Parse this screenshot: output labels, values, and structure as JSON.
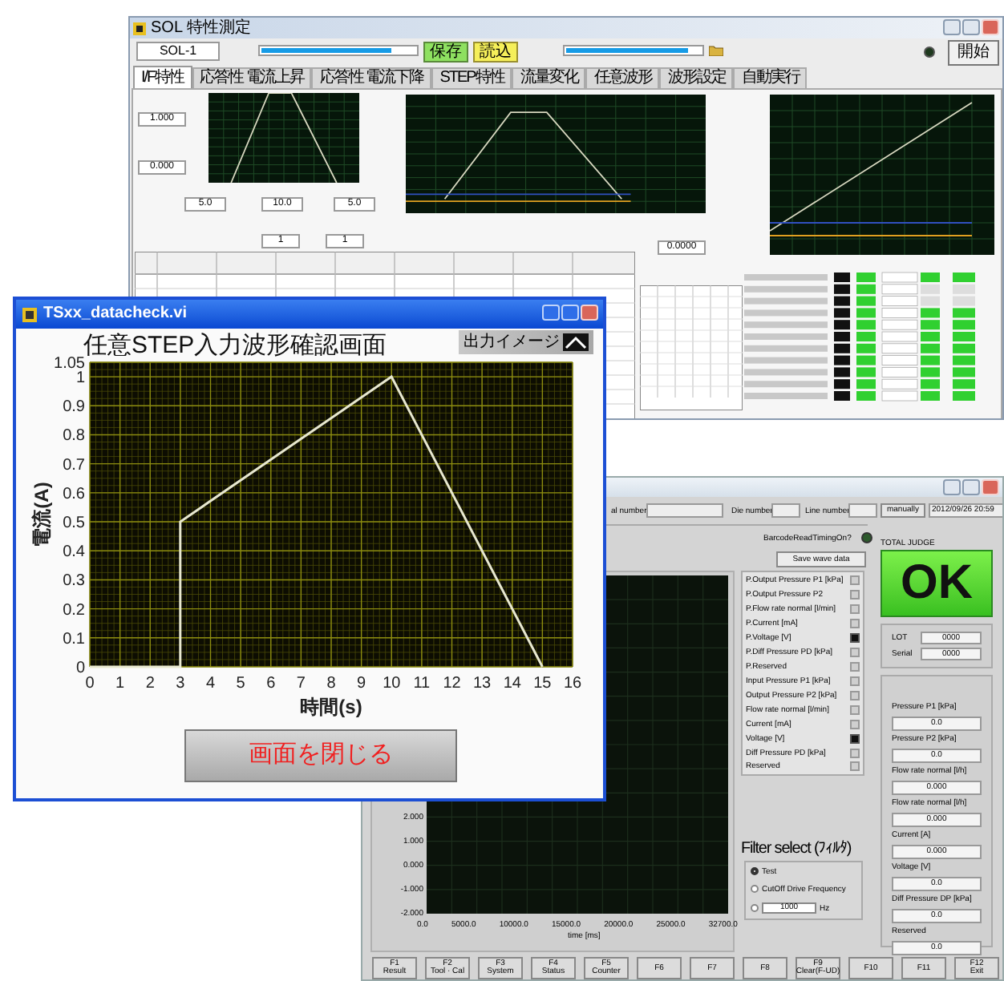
{
  "main_window": {
    "title": "SOL 特性測定",
    "device": "SOL-1",
    "save_button": "保存",
    "load_button": "読込",
    "start_button": "開始",
    "tabs": [
      {
        "label": "I/F特性",
        "selected": true
      },
      {
        "label": "応答性 電流上昇",
        "selected": false
      },
      {
        "label": "応答性 電流下降",
        "selected": false
      },
      {
        "label": "STEP特性",
        "selected": false
      },
      {
        "label": "流量変化",
        "selected": false
      },
      {
        "label": "任意波形",
        "selected": false
      },
      {
        "label": "波形設定",
        "selected": false
      },
      {
        "label": "自動実行",
        "selected": false
      }
    ],
    "fields": [
      "1.000",
      "0.000",
      "5.0",
      "10.0",
      "5.0",
      "1",
      "1",
      "0.0000"
    ]
  },
  "monitor_window": {
    "serial_label": "al number",
    "die_label": "Die number",
    "line_label": "Line number",
    "mode_button": "manually",
    "datetime": "2012/09/26 20:59",
    "barcode_label": "BarcodeReadTimingOn?",
    "total_judge_label": "TOTAL JUDGE",
    "judge": "OK",
    "save_wave_button": "Save wave data",
    "channels": [
      {
        "label": "P.Output Pressure P1 [kPa]",
        "checked": false
      },
      {
        "label": "P.Output Pressure P2",
        "checked": false
      },
      {
        "label": "P.Flow rate normal [l/min]",
        "checked": false
      },
      {
        "label": "P.Current [mA]",
        "checked": false
      },
      {
        "label": "P.Voltage [V]",
        "checked": true
      },
      {
        "label": "P.Diff Pressure PD [kPa]",
        "checked": false
      },
      {
        "label": "P.Reserved",
        "checked": false
      },
      {
        "label": "Input Pressure P1 [kPa]",
        "checked": false
      },
      {
        "label": "Output Pressure P2 [kPa]",
        "checked": false
      },
      {
        "label": "Flow rate normal [l/min]",
        "checked": false
      },
      {
        "label": "Current [mA]",
        "checked": false
      },
      {
        "label": "Voltage [V]",
        "checked": true
      },
      {
        "label": "Diff Pressure PD [kPa]",
        "checked": false
      },
      {
        "label": "Reserved",
        "checked": false
      }
    ],
    "lot": {
      "label": "LOT",
      "value": "0000"
    },
    "serial": {
      "label": "Serial",
      "value": "0000"
    },
    "readings": [
      {
        "label": "Pressure P1 [kPa]",
        "value": "0.0"
      },
      {
        "label": "Pressure P2 [kPa]",
        "value": "0.0"
      },
      {
        "label": "Flow rate normal [l/h]",
        "value": "0.000"
      },
      {
        "label": "Flow rate normal [l/h]",
        "value": "0.000"
      },
      {
        "label": "Current [A]",
        "value": "0.000"
      },
      {
        "label": "Voltage [V]",
        "value": "0.0"
      },
      {
        "label": "Diff Pressure DP [kPa]",
        "value": "0.0"
      },
      {
        "label": "Reserved",
        "value": "0.0"
      }
    ],
    "filter": {
      "label": "Filter select (ﾌｨﾙﾀ)",
      "options": [
        {
          "label": "Test",
          "selected": true
        },
        {
          "label": "CutOff Drive Frequency",
          "selected": false
        },
        {
          "selected": false
        }
      ],
      "frequency": "1000",
      "unit": "Hz"
    },
    "graph": {
      "y_labels": [
        "2.000",
        "1.000",
        "0.000",
        "-1.000",
        "-2.000"
      ],
      "x_labels": [
        "0.0",
        "5000.0",
        "10000.0",
        "15000.0",
        "20000.0",
        "25000.0",
        "32700.0"
      ],
      "x_title": "time [ms]"
    },
    "function_keys": [
      {
        "key": "F1",
        "label": "Result"
      },
      {
        "key": "F2",
        "label": "Tool · Cal"
      },
      {
        "key": "F3",
        "label": "System"
      },
      {
        "key": "F4",
        "label": "Status"
      },
      {
        "key": "F5",
        "label": "Counter"
      },
      {
        "key": "F6"
      },
      {
        "key": "F7"
      },
      {
        "key": "F8"
      },
      {
        "key": "F9",
        "label": "Clear(F-UD)"
      },
      {
        "key": "F10"
      },
      {
        "key": "F11"
      },
      {
        "key": "F12",
        "label": "Exit"
      }
    ]
  },
  "check_window": {
    "title": "TSxx_datacheck.vi",
    "heading": "任意STEP入力波形確認画面",
    "output_image_label": "出力イメージ",
    "chart_data": {
      "type": "line",
      "xlabel": "時間(s)",
      "ylabel": "電流(A)",
      "x": [
        0,
        3,
        3,
        10,
        15
      ],
      "series": [
        {
          "values": [
            0,
            0,
            0.5,
            1,
            0
          ]
        }
      ],
      "xlim": [
        0,
        16
      ],
      "ylim": [
        0,
        1.05
      ],
      "xticks": [
        0,
        1,
        2,
        3,
        4,
        5,
        6,
        7,
        8,
        9,
        10,
        11,
        12,
        13,
        14,
        15,
        16
      ],
      "yticks": [
        0,
        0.1,
        0.2,
        0.3,
        0.4,
        0.5,
        0.6,
        0.7,
        0.8,
        0.9,
        1,
        1.05
      ],
      "grid": true
    },
    "close_button": "画面を閉じる"
  }
}
